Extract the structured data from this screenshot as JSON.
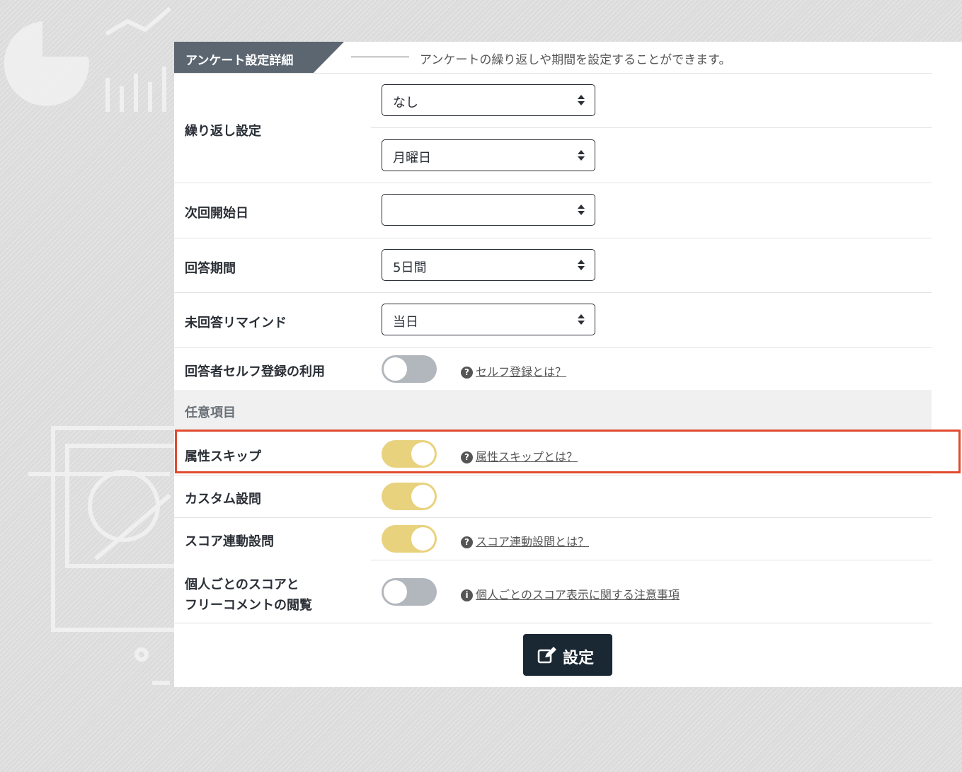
{
  "header": {
    "title": "アンケート設定詳細",
    "description": "アンケートの繰り返しや期間を設定することができます。"
  },
  "rows": {
    "repeat": {
      "label": "繰り返し設定",
      "select1_value": "なし",
      "select2_value": "月曜日"
    },
    "next_start": {
      "label": "次回開始日",
      "value": ""
    },
    "answer_period": {
      "label": "回答期間",
      "value": "5日間"
    },
    "reminder": {
      "label": "未回答リマインド",
      "value": "当日"
    },
    "self_register": {
      "label": "回答者セルフ登録の利用",
      "toggle": "off",
      "help": "セルフ登録とは？"
    }
  },
  "optional_section": {
    "title": "任意項目",
    "attribute_skip": {
      "label": "属性スキップ",
      "toggle": "on",
      "help": "属性スキップとは？"
    },
    "custom_question": {
      "label": "カスタム設問",
      "toggle": "on"
    },
    "score_linked": {
      "label": "スコア連動設問",
      "toggle": "on",
      "help": "スコア連動設問とは？"
    },
    "personal_score": {
      "label_line1": "個人ごとのスコアと",
      "label_line2": "フリーコメントの閲覧",
      "toggle": "off",
      "help": "個人ごとのスコア表示に関する注意事項"
    }
  },
  "submit": {
    "label": "設定",
    "icon": "edit-icon"
  },
  "colors": {
    "header_tab": "#5b6670",
    "toggle_on": "#e9d27e",
    "toggle_off": "#b2b7bd",
    "button": "#1a2833",
    "highlight": "#e04a2f"
  }
}
